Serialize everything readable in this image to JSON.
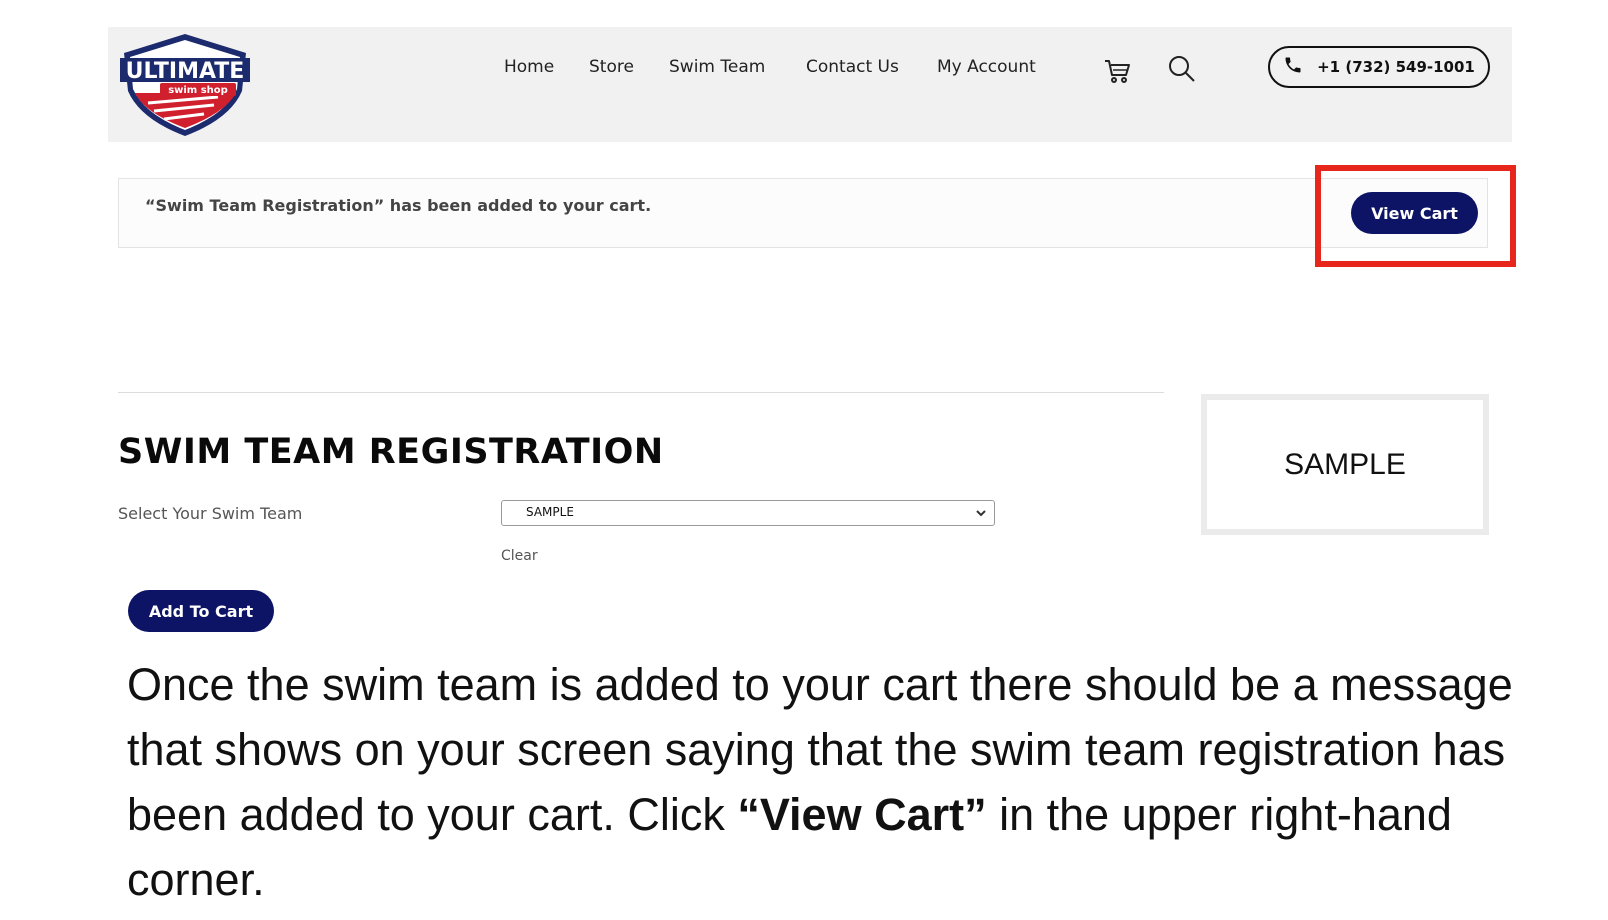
{
  "header": {
    "logo": {
      "word1": "ULTIMATE",
      "word2": "swim shop",
      "colors": {
        "navy": "#1c2a6e",
        "red": "#d0202e",
        "white": "#ffffff"
      }
    },
    "nav": [
      {
        "label": "Home"
      },
      {
        "label": "Store"
      },
      {
        "label": "Swim Team"
      },
      {
        "label": "Contact Us"
      },
      {
        "label": "My Account"
      }
    ],
    "icons": {
      "cart": "cart-icon",
      "search": "search-icon",
      "phone": "phone-icon"
    },
    "phone": "+1 (732) 549-1001"
  },
  "notice": {
    "message": "“Swim Team Registration” has been added to your cart.",
    "button_label": "View Cart"
  },
  "product": {
    "title": "SWIM TEAM REGISTRATION",
    "image_placeholder": "SAMPLE",
    "field_label": "Select Your Swim Team",
    "selected_value": "SAMPLE",
    "clear_label": "Clear",
    "add_to_cart_label": "Add To Cart"
  },
  "instruction": {
    "text_before": "Once the swim team is added to your cart there should be a message that shows on your screen saying that the swim team registration has been added to your cart. Click ",
    "emphasis": "“View Cart”",
    "text_after": " in the upper right-hand corner."
  },
  "colors": {
    "button_navy": "#0d1466",
    "highlight_red": "#e8271c",
    "header_bg": "#f1f1f1"
  }
}
